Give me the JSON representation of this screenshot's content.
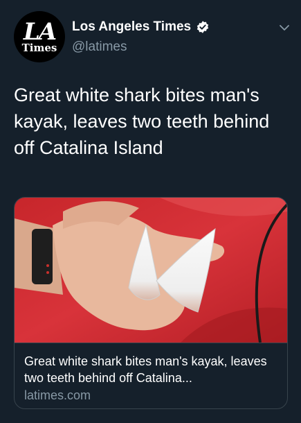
{
  "account": {
    "avatar_line1": "LA",
    "avatar_line2": "Times",
    "display_name": "Los Angeles Times",
    "handle": "@latimes",
    "verified": true
  },
  "tweet": {
    "text": "Great white shark bites man's kayak, leaves two teeth behind off Catalina Island"
  },
  "link_card": {
    "image_icon": "shark-teeth-in-hand-photo",
    "title": "Great white shark bites man's kayak, leaves two teeth behind off Catalina...",
    "domain": "latimes.com"
  },
  "colors": {
    "background": "#15202b",
    "secondary_text": "#8899a6",
    "verified_badge": "#ffffff",
    "border": "#38444d"
  }
}
